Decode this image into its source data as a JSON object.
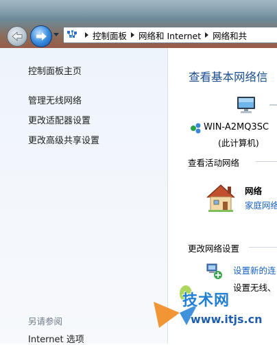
{
  "breadcrumb": [
    "控制面板",
    "网络和 Internet",
    "网络和共"
  ],
  "left_pane": {
    "home": "控制面板主页",
    "links": [
      "管理无线网络",
      "更改适配器设置",
      "更改高级共享设置"
    ],
    "see_also_header": "另请参阅",
    "see_also_links": [
      "Internet 选项"
    ]
  },
  "main": {
    "title": "查看基本网络信",
    "computer_name": "WIN-A2MQ3SC",
    "computer_sub": "(此计算机)",
    "active_networks_header": "查看活动网络",
    "network_name": "网络",
    "network_type": "家庭网络",
    "change_settings_header": "更改网络设置",
    "setup_link": "设置新的连",
    "setup_desc": "设置无线、"
  },
  "watermark": {
    "text1": "技术网",
    "text2": "www.itjs.cn"
  },
  "colors": {
    "link": "#1862c4",
    "title": "#1e4f8f",
    "left_pane_bg": "#eef4fb"
  }
}
